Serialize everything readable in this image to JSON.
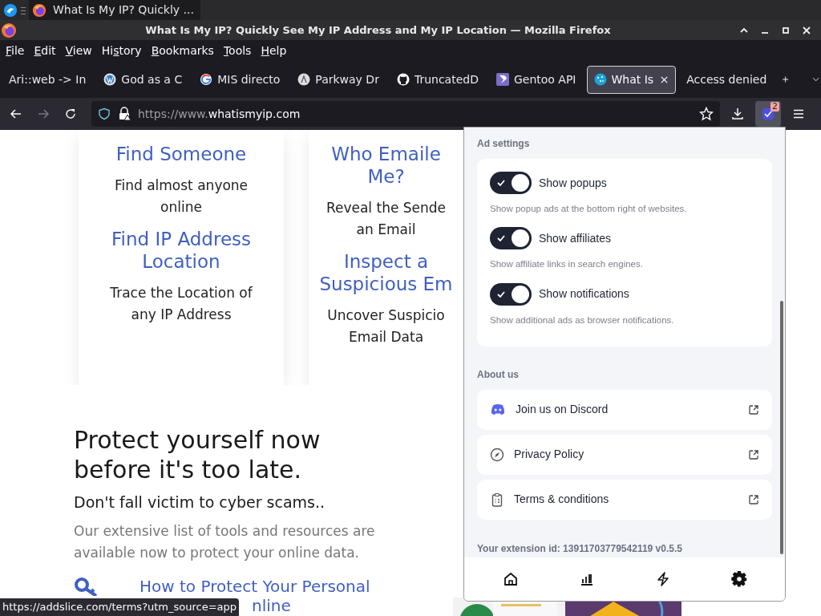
{
  "taskbar": {
    "task_title": "What Is My IP? Quickly ..."
  },
  "window": {
    "title": "What Is My IP? Quickly See My IP Address and My IP Location — Mozilla Firefox"
  },
  "menu": [
    "File",
    "Edit",
    "View",
    "History",
    "Bookmarks",
    "Tools",
    "Help"
  ],
  "tabs": [
    {
      "label": "Ari::web -> In",
      "kind": "none",
      "selected": false
    },
    {
      "label": "God as a C",
      "kind": "wordpress",
      "selected": false
    },
    {
      "label": "MIS directo",
      "kind": "google",
      "selected": false
    },
    {
      "label": "Parkway Dr",
      "kind": "circle",
      "selected": false
    },
    {
      "label": "TruncatedD",
      "kind": "github",
      "selected": false
    },
    {
      "label": "Gentoo API",
      "kind": "gentoo",
      "selected": false
    },
    {
      "label": "What Is",
      "kind": "globe",
      "selected": true
    },
    {
      "label": "Access denied",
      "kind": "none",
      "selected": false
    }
  ],
  "address_bar": {
    "prefix": "https://www.",
    "domain": "whatismyip.com"
  },
  "extension_badge": "2",
  "page": {
    "cards": [
      {
        "items": [
          {
            "title_lines": [
              "Find Someone"
            ],
            "text_lines": [
              "Find almost anyone",
              "online"
            ]
          },
          {
            "title_lines": [
              "Find IP Address",
              "Location"
            ],
            "text_lines": [
              "Trace the Location of",
              "any IP Address"
            ]
          }
        ]
      },
      {
        "items": [
          {
            "title_lines": [
              "Who Emaile",
              "Me?"
            ],
            "text_lines": [
              "Reveal the Sende",
              "an Email"
            ]
          },
          {
            "title_lines": [
              "Inspect a",
              "Suspicious Em"
            ],
            "text_lines": [
              "Uncover Suspicio",
              "Email Data"
            ]
          }
        ]
      }
    ],
    "heading_lines": [
      "Protect yourself now",
      "before it's too late."
    ],
    "subheading": "Don't fall victim to cyber scams..",
    "paragraph": "Our extensive list of tools and resources are available now to protect your online data.",
    "link_lines": [
      "How to Protect Your Personal",
      "nline"
    ]
  },
  "popup": {
    "ad_settings_title": "Ad settings",
    "toggles": [
      {
        "label": "Show popups",
        "description": "Show popup ads at the bottom right of websites.",
        "on": true
      },
      {
        "label": "Show affiliates",
        "description": "Show affiliate links in search engines.",
        "on": true
      },
      {
        "label": "Show notifications",
        "description": "Show additional ads as browser notifications.",
        "on": true
      }
    ],
    "about_title": "About us",
    "links": [
      {
        "label": "Join us on Discord",
        "kind": "discord"
      },
      {
        "label": "Privacy Policy",
        "kind": "compass"
      },
      {
        "label": "Terms & conditions",
        "kind": "clipboard"
      }
    ],
    "extension_id": "Your extension id: 13911703779542119 v0.5.5",
    "nav": [
      {
        "kind": "home"
      },
      {
        "kind": "stats"
      },
      {
        "kind": "bolt"
      },
      {
        "kind": "settings"
      }
    ]
  },
  "status_url": "https://addslice.com/terms?utm_source=app"
}
